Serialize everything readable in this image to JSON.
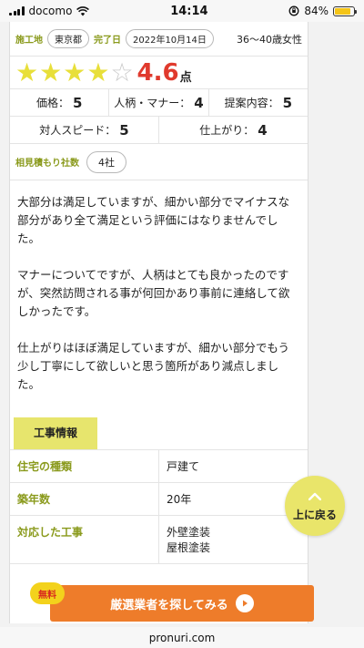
{
  "status": {
    "carrier": "docomo",
    "time": "14:14",
    "battery_text": "84%",
    "battery_level": 0.84
  },
  "meta": {
    "location_label": "施工地",
    "location": "東京都",
    "completion_label": "完了日",
    "completion_date": "2022年10月14日",
    "reviewer": "36〜40歳女性"
  },
  "rating": {
    "stars_filled": 4,
    "stars_total": 5,
    "score": "4.6",
    "unit": "点"
  },
  "scores": {
    "price_label": "価格：",
    "price": "5",
    "manner_label": "人柄・マナー：",
    "manner": "4",
    "proposal_label": "提案内容：",
    "proposal": "5",
    "speed_label": "対人スピード：",
    "speed": "5",
    "finish_label": "仕上がり：",
    "finish": "4"
  },
  "estimate": {
    "label": "相見積もり社数",
    "count": "4社"
  },
  "review": [
    "大部分は満足していますが、細かい部分でマイナスな部分があり全て満足という評価にはなりませんでした。",
    "マナーについてですが、人柄はとても良かったのですが、突然訪問される事が何回かあり事前に連絡して欲しかったです。",
    "仕上がりはほぼ満足していますが、細かい部分でもう少し丁寧にして欲しいと思う箇所があり減点しました。"
  ],
  "work_info": {
    "heading": "工事情報",
    "rows": [
      {
        "key": "住宅の種類",
        "value": "戸建て"
      },
      {
        "key": "築年数",
        "value": "20年"
      },
      {
        "key": "対応した工事",
        "value": "外壁塗装\n屋根塗装"
      }
    ]
  },
  "top_button": {
    "label": "上に戻る"
  },
  "cta": {
    "badge": "無料",
    "label": "厳選業者を探してみる"
  },
  "url": "pronuri.com"
}
